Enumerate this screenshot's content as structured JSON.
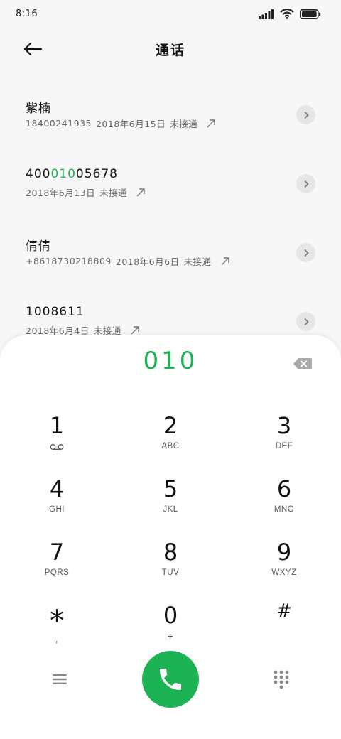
{
  "status_bar": {
    "time": "8:16"
  },
  "header": {
    "title": "通话"
  },
  "calls": [
    {
      "name": "紫楠",
      "number": "18400241935",
      "date": "2018年6月15日",
      "status": "未接通"
    },
    {
      "name_prefix": "400",
      "name_highlight": "010",
      "name_suffix": "05678",
      "date": "2018年6月13日",
      "status": "未接通"
    },
    {
      "name": "倩倩",
      "number": "+8618730218809",
      "date": "2018年6月6日",
      "status": "未接通"
    },
    {
      "name": "1008611",
      "date": "2018年6月4日",
      "status": "未接通"
    }
  ],
  "dialpad": {
    "entered_number": "010",
    "keys": [
      {
        "digit": "1",
        "sub": ""
      },
      {
        "digit": "2",
        "sub": "ABC"
      },
      {
        "digit": "3",
        "sub": "DEF"
      },
      {
        "digit": "4",
        "sub": "GHI"
      },
      {
        "digit": "5",
        "sub": "JKL"
      },
      {
        "digit": "6",
        "sub": "MNO"
      },
      {
        "digit": "7",
        "sub": "PQRS"
      },
      {
        "digit": "8",
        "sub": "TUV"
      },
      {
        "digit": "9",
        "sub": "WXYZ"
      },
      {
        "digit": "*",
        "sub": ","
      },
      {
        "digit": "0",
        "sub": "+"
      },
      {
        "digit": "#",
        "sub": ""
      }
    ]
  },
  "colors": {
    "accent_green": "#1db355",
    "background": "#f7f7f7",
    "panel": "#ffffff"
  },
  "icons": {
    "back": "arrow-left-icon",
    "detail": "chevron-right-icon",
    "outgoing": "arrow-up-right-icon",
    "voicemail": "voicemail-icon",
    "backspace": "backspace-icon",
    "menu": "menu-icon",
    "call": "phone-icon",
    "keypad": "keypad-icon"
  }
}
